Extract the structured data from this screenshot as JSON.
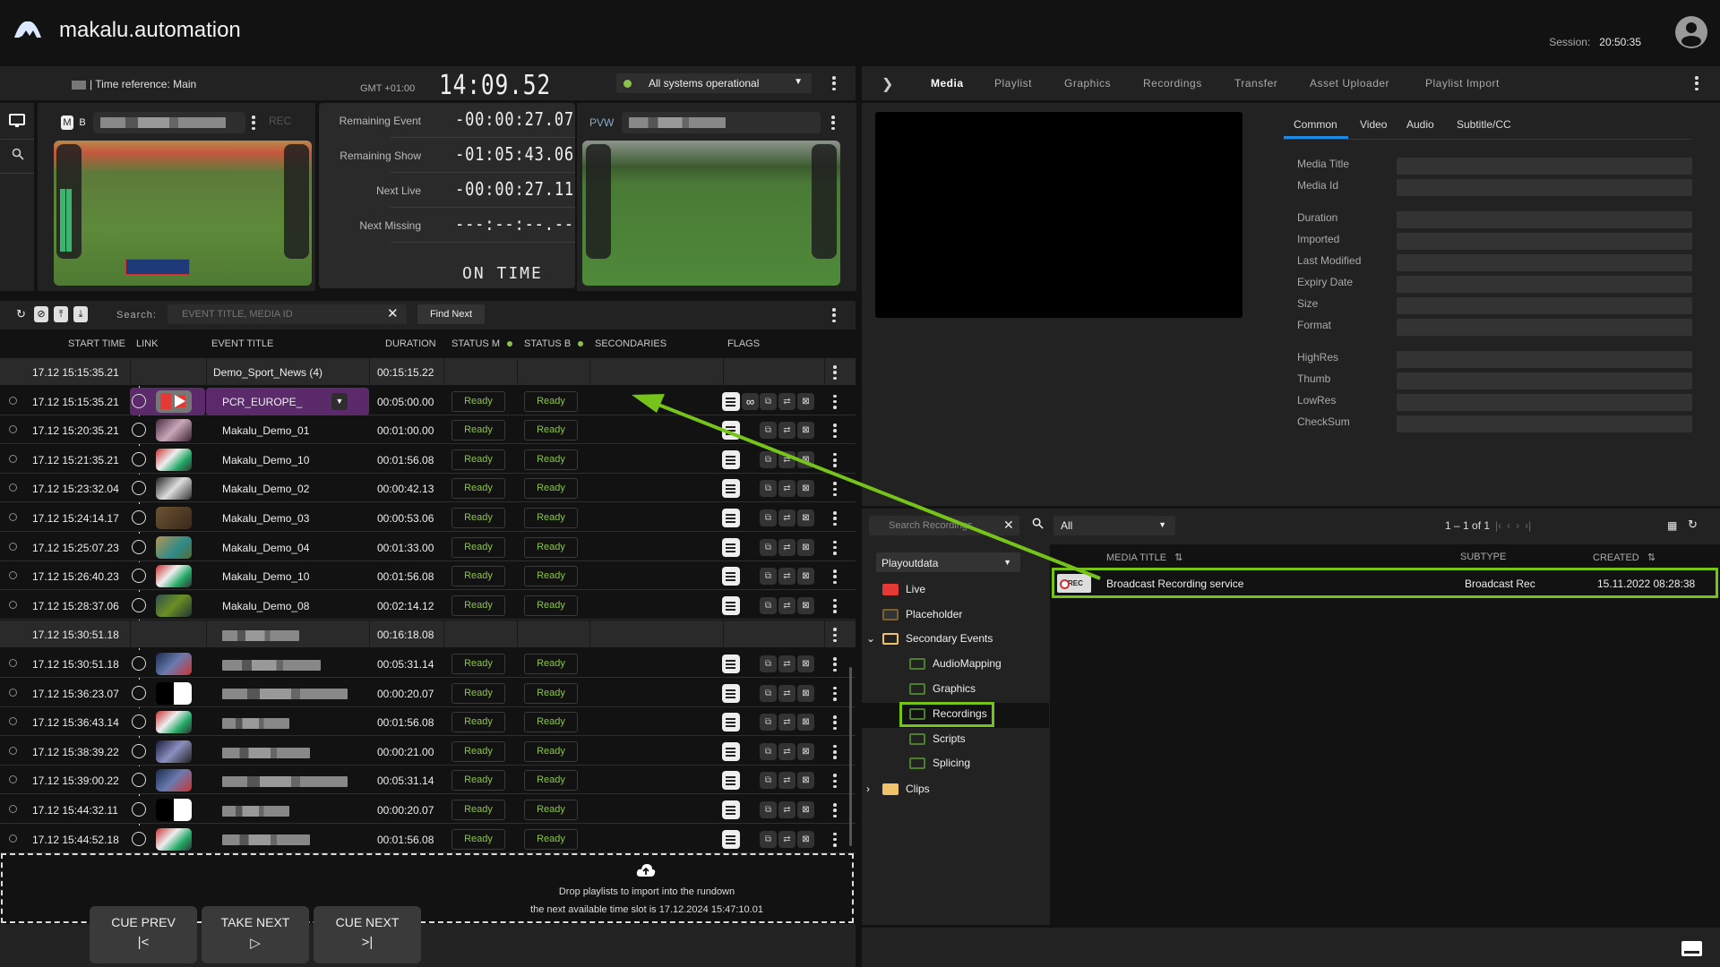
{
  "app": {
    "brand": "makalu.automation",
    "session_label": "Session:",
    "session_value": "20:50:35"
  },
  "toolbar_left": {
    "time_reference": "| Time reference: Main",
    "timezone": "GMT +01:00",
    "clock": "14:09.52",
    "system_status": "All systems operational",
    "status_color": "#8bc34a"
  },
  "sidebar_icons": [
    "monitor-icon",
    "search-icon"
  ],
  "program_monitor": {
    "badge_m": "M",
    "badge_b": "B",
    "rec_label": "REC"
  },
  "preview_monitor": {
    "label": "PVW"
  },
  "timers": [
    {
      "label": "Remaining Event",
      "value": "-00:00:27.07"
    },
    {
      "label": "Remaining Show",
      "value": "-01:05:43.06"
    },
    {
      "label": "Next Live",
      "value": "-00:00:27.11"
    },
    {
      "label": "Next Missing",
      "value": "---:--:--.--"
    }
  ],
  "on_time": "ON TIME",
  "rundown_toolbar": {
    "search_label": "Search:",
    "search_placeholder": "EVENT TITLE, MEDIA ID",
    "find_next": "Find Next"
  },
  "columns": {
    "start_time": "START TIME",
    "link": "LINK",
    "event_title": "EVENT TITLE",
    "duration": "DURATION",
    "status_m": "STATUS M",
    "status_b": "STATUS B",
    "secondaries": "SECONDARIES",
    "flags": "FLAGS"
  },
  "rundown": [
    {
      "type": "group",
      "start": "17.12  15:15:35.21",
      "title": "Demo_Sport_News (4)",
      "duration": "00:15:15.22"
    },
    {
      "type": "event",
      "start": "17.12  15:15:35.21",
      "title": "PCR_EUROPE_",
      "duration": "00:05:00.00",
      "status_m": "Ready",
      "status_b": "Ready",
      "live": true,
      "thumb": "live"
    },
    {
      "type": "event",
      "start": "17.12  15:20:35.21",
      "title": "Makalu_Demo_01",
      "duration": "00:01:00.00",
      "status_m": "Ready",
      "status_b": "Ready",
      "thumb": "t1"
    },
    {
      "type": "event",
      "start": "17.12  15:21:35.21",
      "title": "Makalu_Demo_10",
      "duration": "00:01:56.08",
      "status_m": "Ready",
      "status_b": "Ready",
      "thumb": "t2"
    },
    {
      "type": "event",
      "start": "17.12  15:23:32.04",
      "title": "Makalu_Demo_02",
      "duration": "00:00:42.13",
      "status_m": "Ready",
      "status_b": "Ready",
      "thumb": "t3"
    },
    {
      "type": "event",
      "start": "17.12  15:24:14.17",
      "title": "Makalu_Demo_03",
      "duration": "00:00:53.06",
      "status_m": "Ready",
      "status_b": "Ready",
      "thumb": "t4"
    },
    {
      "type": "event",
      "start": "17.12  15:25:07.23",
      "title": "Makalu_Demo_04",
      "duration": "00:01:33.00",
      "status_m": "Ready",
      "status_b": "Ready",
      "thumb": "t5"
    },
    {
      "type": "event",
      "start": "17.12  15:26:40.23",
      "title": "Makalu_Demo_10",
      "duration": "00:01:56.08",
      "status_m": "Ready",
      "status_b": "Ready",
      "thumb": "t2"
    },
    {
      "type": "event",
      "start": "17.12  15:28:37.06",
      "title": "Makalu_Demo_08",
      "duration": "00:02:14.12",
      "status_m": "Ready",
      "status_b": "Ready",
      "thumb": "t6"
    },
    {
      "type": "group",
      "start": "17.12  15:30:51.18",
      "title": "",
      "duration": "00:16:18.08",
      "blurred": true
    },
    {
      "type": "event",
      "start": "17.12  15:30:51.18",
      "title": "",
      "duration": "00:05:31.14",
      "status_m": "Ready",
      "status_b": "Ready",
      "blurred": true,
      "thumb": "t7"
    },
    {
      "type": "event",
      "start": "17.12  15:36:23.07",
      "title": "",
      "duration": "00:00:20.07",
      "status_m": "Ready",
      "status_b": "Ready",
      "blurred": true,
      "thumb": "t8"
    },
    {
      "type": "event",
      "start": "17.12  15:36:43.14",
      "title": "",
      "duration": "00:01:56.08",
      "status_m": "Ready",
      "status_b": "Ready",
      "blurred": true,
      "thumb": "t2"
    },
    {
      "type": "event",
      "start": "17.12  15:38:39.22",
      "title": "",
      "duration": "00:00:21.00",
      "status_m": "Ready",
      "status_b": "Ready",
      "blurred": true,
      "thumb": "t9"
    },
    {
      "type": "event",
      "start": "17.12  15:39:00.22",
      "title": "",
      "duration": "00:05:31.14",
      "status_m": "Ready",
      "status_b": "Ready",
      "blurred": true,
      "thumb": "t7"
    },
    {
      "type": "event",
      "start": "17.12  15:44:32.11",
      "title": "",
      "duration": "00:00:20.07",
      "status_m": "Ready",
      "status_b": "Ready",
      "blurred": true,
      "thumb": "t8"
    },
    {
      "type": "event",
      "start": "17.12  15:44:52.18",
      "title": "",
      "duration": "00:01:56.08",
      "status_m": "Ready",
      "status_b": "Ready",
      "blurred": true,
      "thumb": "t2"
    }
  ],
  "dropzone": {
    "line1": "Drop playlists to import into the rundown",
    "line2": "the next available time slot is 17.12.2024 15:47:10.01"
  },
  "transport": [
    {
      "label": "CUE PREV",
      "glyph": "|<"
    },
    {
      "label": "TAKE NEXT",
      "glyph": "▷"
    },
    {
      "label": "CUE NEXT",
      "glyph": ">|"
    }
  ],
  "right_tabs": [
    "Media",
    "Playlist",
    "Graphics",
    "Recordings",
    "Transfer",
    "Asset Uploader",
    "Playlist Import"
  ],
  "active_right_tab": "Media",
  "property_tabs": [
    "Common",
    "Video",
    "Audio",
    "Subtitle/CC"
  ],
  "active_property_tab": "Common",
  "properties": [
    {
      "label": "Media Title",
      "value": ""
    },
    {
      "label": "Media Id",
      "value": ""
    },
    {
      "label": "Duration",
      "value": ""
    },
    {
      "label": "Imported",
      "value": ""
    },
    {
      "label": "Last Modified",
      "value": ""
    },
    {
      "label": "Expiry Date",
      "value": ""
    },
    {
      "label": "Size",
      "value": ""
    },
    {
      "label": "Format",
      "value": ""
    },
    {
      "label": "HighRes",
      "value": ""
    },
    {
      "label": "Thumb",
      "value": ""
    },
    {
      "label": "LowRes",
      "value": ""
    },
    {
      "label": "CheckSum",
      "value": ""
    }
  ],
  "browser": {
    "search_placeholder": "Search Recordings",
    "filter": "All",
    "pager": "1 – 1 of 1",
    "source": "Playoutdata",
    "tree": [
      {
        "label": "Live",
        "icon": "live-icon",
        "level": 0
      },
      {
        "label": "Placeholder",
        "icon": "placeholder-icon",
        "level": 0
      },
      {
        "label": "Secondary Events",
        "icon": "folder-open-icon",
        "level": 0,
        "expanded": true
      },
      {
        "label": "AudioMapping",
        "icon": "folder-icon",
        "level": 1
      },
      {
        "label": "Graphics",
        "icon": "folder-icon",
        "level": 1
      },
      {
        "label": "Recordings",
        "icon": "folder-icon",
        "level": 1,
        "selected": true
      },
      {
        "label": "Scripts",
        "icon": "folder-icon",
        "level": 1
      },
      {
        "label": "Splicing",
        "icon": "folder-icon",
        "level": 1
      },
      {
        "label": "Clips",
        "icon": "folder-filled-icon",
        "level": 0,
        "expanded": false
      }
    ],
    "columns": {
      "title": "MEDIA TITLE",
      "subtype": "SUBTYPE",
      "created": "CREATED"
    },
    "items": [
      {
        "thumb_label": "REC",
        "title": "Broadcast Recording service",
        "subtype": "Broadcast Rec",
        "created": "15.11.2022 08:28:38"
      }
    ]
  },
  "highlight_color": "#76c41a"
}
